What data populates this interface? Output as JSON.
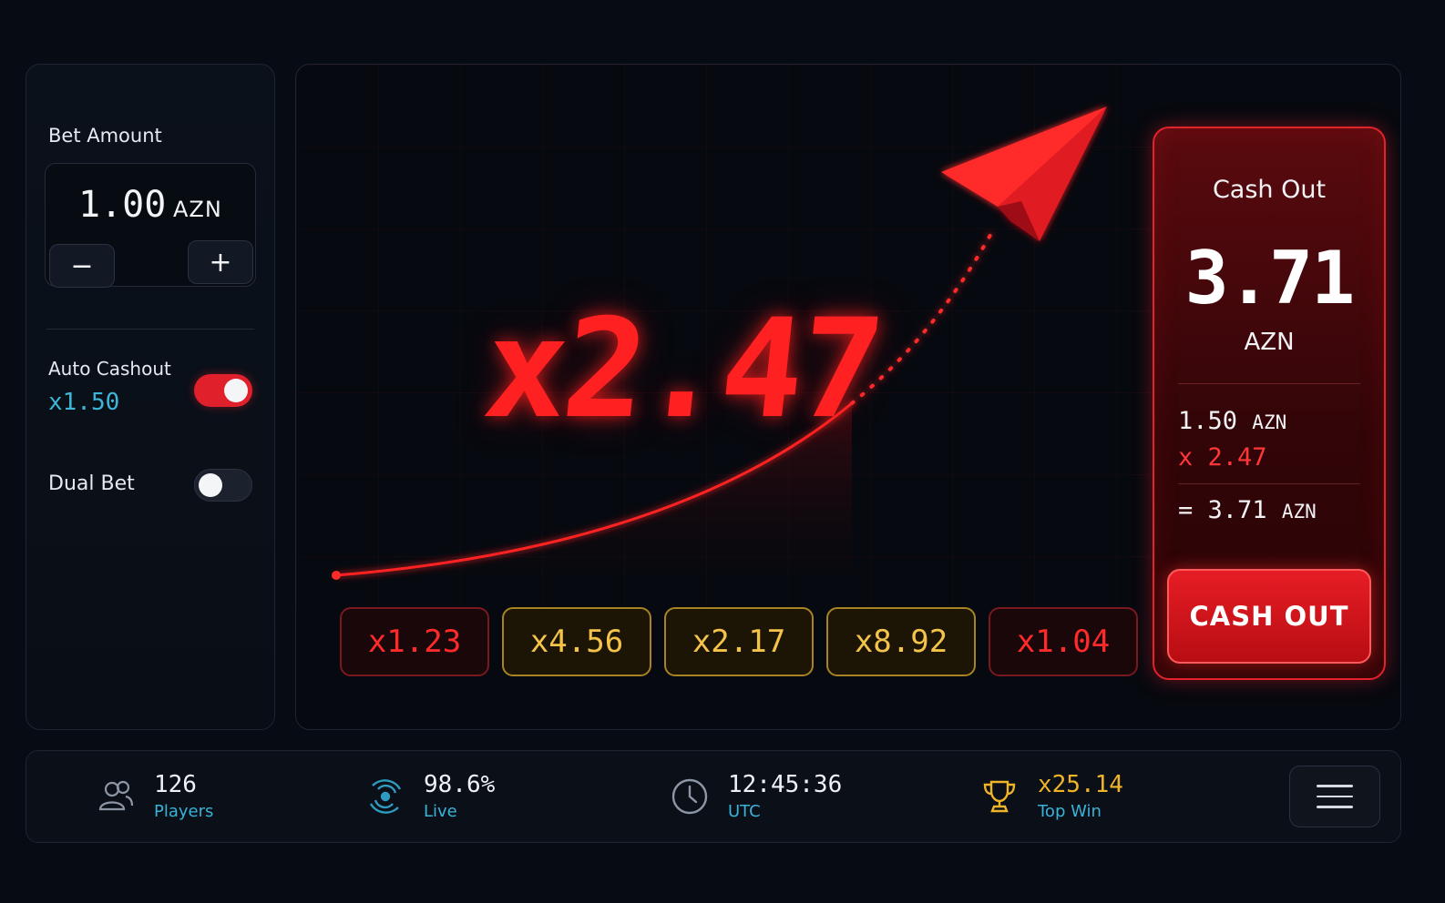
{
  "bet": {
    "label": "Bet Amount",
    "value": "1.00",
    "currency": "AZN",
    "minus_symbol": "−",
    "plus_symbol": "+"
  },
  "auto_cashout": {
    "label": "Auto Cashout",
    "value": "x1.50",
    "enabled": true
  },
  "dual_bet": {
    "label": "Dual Bet",
    "enabled": false
  },
  "game": {
    "multiplier": "x2.47",
    "history": [
      {
        "value": "x1.23",
        "tone": "red"
      },
      {
        "value": "x4.56",
        "tone": "gold"
      },
      {
        "value": "x2.17",
        "tone": "gold"
      },
      {
        "value": "x8.92",
        "tone": "gold"
      },
      {
        "value": "x1.04",
        "tone": "red"
      }
    ]
  },
  "cashout": {
    "title": "Cash Out",
    "amount": "3.71",
    "currency": "AZN",
    "bet_value": "1.50",
    "bet_currency": "AZN",
    "multiplier_line": "x 2.47",
    "result_prefix": "=",
    "result_value": "3.71",
    "result_currency": "AZN",
    "button_label": "CASH OUT"
  },
  "stats": {
    "players_value": "126",
    "players_label": "Players",
    "live_value": "98.6%",
    "live_label": "Live",
    "time_value": "12:45:36",
    "time_label": "UTC",
    "topwin_value": "x25.14",
    "topwin_label": "Top Win"
  },
  "icons": {
    "players": "users-icon",
    "live": "radar-icon",
    "time": "clock-icon",
    "topwin": "trophy-icon",
    "menu": "hamburger-menu-icon",
    "plane": "paper-plane-icon"
  },
  "colors": {
    "accent_red": "#ff2121",
    "accent_cyan": "#3ab3d8",
    "accent_gold": "#f0b429",
    "background": "#070b13"
  }
}
